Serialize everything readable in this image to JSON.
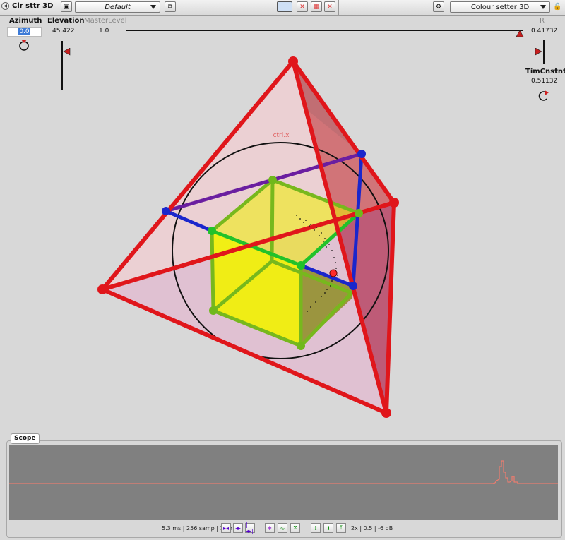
{
  "toolbar": {
    "title": "Clr sttr 3D",
    "preset": "Default",
    "module": "Colour setter 3D"
  },
  "params": {
    "azimuth": {
      "label": "Azimuth",
      "value": "0.0"
    },
    "elevation": {
      "label": "Elevation",
      "value": "45.422"
    },
    "masterlevel": {
      "label": "MasterLevel",
      "value": "1.0"
    },
    "r": {
      "label": "R",
      "value": "0.41732"
    },
    "timconst": {
      "label": "TimCnstnt",
      "value": "0.51132"
    }
  },
  "canvas": {
    "ctrl_label": "ctrl.x"
  },
  "scope": {
    "title": "Scope",
    "stats": "5.3 ms | 256 samp | 1/4x",
    "gain": "2x | 0.5 | -6 dB"
  },
  "colors": {
    "accent_red": "#e0161b",
    "blue": "#1a26cc",
    "green": "#33cc33",
    "purple": "#6a1ea0",
    "yellow": "#f0f000"
  }
}
